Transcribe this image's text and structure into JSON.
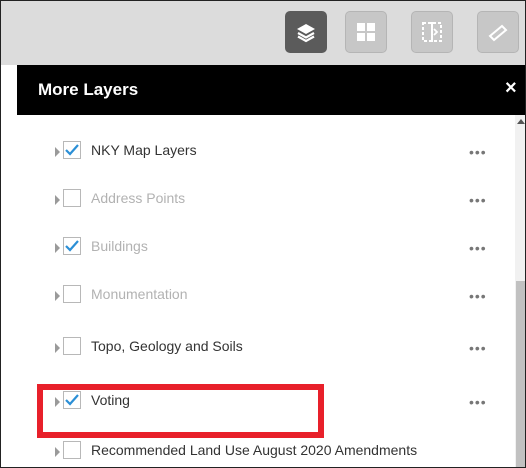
{
  "toolbar": {
    "buttons": [
      {
        "icon": "layers-icon",
        "state": "active"
      },
      {
        "icon": "grid-icon",
        "state": "inactive"
      },
      {
        "icon": "swipe-icon",
        "state": "inactive"
      },
      {
        "icon": "measure-icon",
        "state": "inactive"
      }
    ]
  },
  "panel": {
    "title": "More Layers",
    "close_label": "×"
  },
  "layers": [
    {
      "label": "NKY Map Layers",
      "checked": true,
      "enabled": true
    },
    {
      "label": "Address Points",
      "checked": false,
      "enabled": false
    },
    {
      "label": "Buildings",
      "checked": true,
      "enabled": false
    },
    {
      "label": "Monumentation",
      "checked": false,
      "enabled": false
    },
    {
      "label": "Topo, Geology and Soils",
      "checked": false,
      "enabled": true
    },
    {
      "label": "Voting",
      "checked": true,
      "enabled": true
    },
    {
      "label": "Recommended Land Use August 2020 Amendments",
      "checked": false,
      "enabled": true
    }
  ],
  "more_options_label": "•••",
  "colors": {
    "toolbar_bg": "#dcdcdc",
    "active_button": "#5b5b5b",
    "header_bg": "#000000",
    "checkmark": "#2b8fd6",
    "highlight": "#e8202a"
  }
}
